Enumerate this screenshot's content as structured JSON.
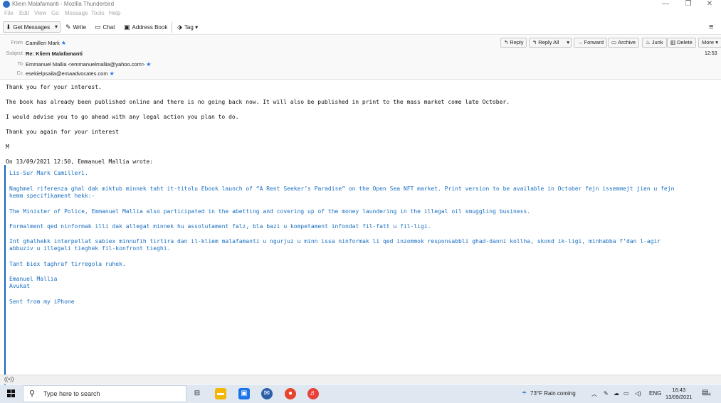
{
  "window": {
    "title": "Kliem Malafamanti - Mozilla Thunderbird",
    "controls": {
      "minimize": "—",
      "restore": "❐",
      "close": "✕"
    }
  },
  "menu": [
    "File",
    "Edit",
    "View",
    "Go",
    "Message",
    "Tools",
    "Help"
  ],
  "toolbar": {
    "get_messages": "Get Messages",
    "write": "Write",
    "chat": "Chat",
    "address_book": "Address Book",
    "tag": "Tag",
    "menu_icon": "≡"
  },
  "header": {
    "from_label": "From",
    "from_value": "Camilleri Mark",
    "subject_label": "Subject",
    "subject_value": "Re: Kliem Malafamanti",
    "to_label": "To",
    "to_value": "Emmanuel Mallia <emmanuelmallia@yahoo.com>",
    "cc_label": "Cc",
    "cc_value": "esekielpsaila@emaadvocates.com",
    "time": "12:53",
    "actions": {
      "reply": "Reply",
      "reply_all": "Reply All",
      "forward": "Forward",
      "archive": "Archive",
      "junk": "Junk",
      "delete": "Delete",
      "more": "More"
    }
  },
  "body": {
    "lines": [
      "Thank you for your interest.",
      "The book has already been published online and there is no going back now. It will also be published in print to the mass market come late October.",
      "I would advise you to go ahead with any legal action you plan to do.",
      "Thank you again for your interest",
      "M",
      "On 13/09/2021 12:50, Emmanuel Mallia wrote:"
    ],
    "quote": [
      "Lis-Sur Mark Camilleri.",
      "Naghmel riferenza ghal dak miktub minnek taht it-titolu Ebook launch of “A Rent Seeker’s Paradise” on the Open Sea NFT market. Print version to be available in October fejn issemmejt jien u fejn",
      "hemm specifikament hekk:-",
      "The Minister of Police, Emmanuel Mallia also participated in the abetting and covering up of the money laundering in the illegal oil smuggling business.",
      "Formalment qed ninformak illi dak allegat minnek hu assolutament falz, bla bazi u kompetament infondat fil-fatt u fil-ligi.",
      "Int ghalhekk interpellat sabiex minnufih tirtira dan il-kliem malafamanti u ngurjuz u minn issa ninformak li qed inzommok responsabbli ghad-danni kollha, skond ik-ligi, minhabba f’dan l-agir",
      "abbuziv u illegali tieghek fil-konfront tieghi.",
      "Tant biex taghraf tirregola ruhek.",
      "Emanuel Mallia",
      "Avukat",
      "Sent from my iPhone"
    ]
  },
  "statusbar": {
    "icon": "((•))"
  },
  "taskbar": {
    "search_placeholder": "Type here to search",
    "weather": "73°F  Rain coming",
    "lang": "ENG",
    "time": "16:43",
    "date": "13/09/2021",
    "notif_count": "4"
  }
}
